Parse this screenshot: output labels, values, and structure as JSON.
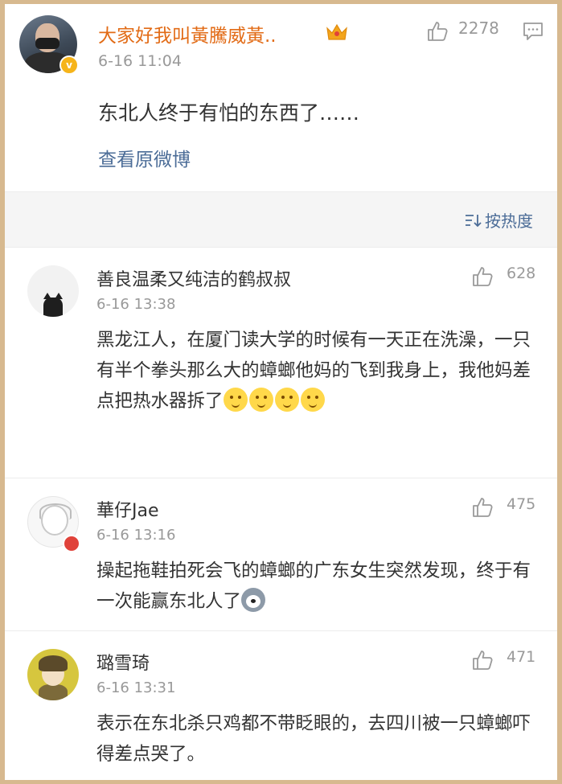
{
  "post": {
    "author": "大家好我叫黃騰威黃..",
    "time": "6-16 11:04",
    "likes": "2278",
    "text": "东北人终于有怕的东西了……",
    "view_original": "查看原微博",
    "verified_mark": "v"
  },
  "sort": {
    "label": "按热度",
    "icon": "sort-icon"
  },
  "comments": [
    {
      "user": "善良温柔又纯洁的鹤叔叔",
      "time": "6-16 13:38",
      "likes": "628",
      "text": "黑龙江人，在厦门读大学的时候有一天正在洗澡，一只有半个拳头那么大的蟑螂他妈的飞到我身上，我他妈差点把热水器拆了"
    },
    {
      "user": "華仔Jae",
      "time": "6-16 13:16",
      "likes": "475",
      "text": "操起拖鞋拍死会飞的蟑螂的广东女生突然发现，终于有一次能赢东北人了"
    },
    {
      "user": "璐雪琦",
      "time": "6-16 13:31",
      "likes": "471",
      "text": "表示在东北杀只鸡都不带眨眼的，去四川被一只蟑螂吓得差点哭了。"
    }
  ],
  "colors": {
    "accent_orange": "#e26b16",
    "link_blue": "#4b6c97",
    "border": "#d7b98f"
  }
}
